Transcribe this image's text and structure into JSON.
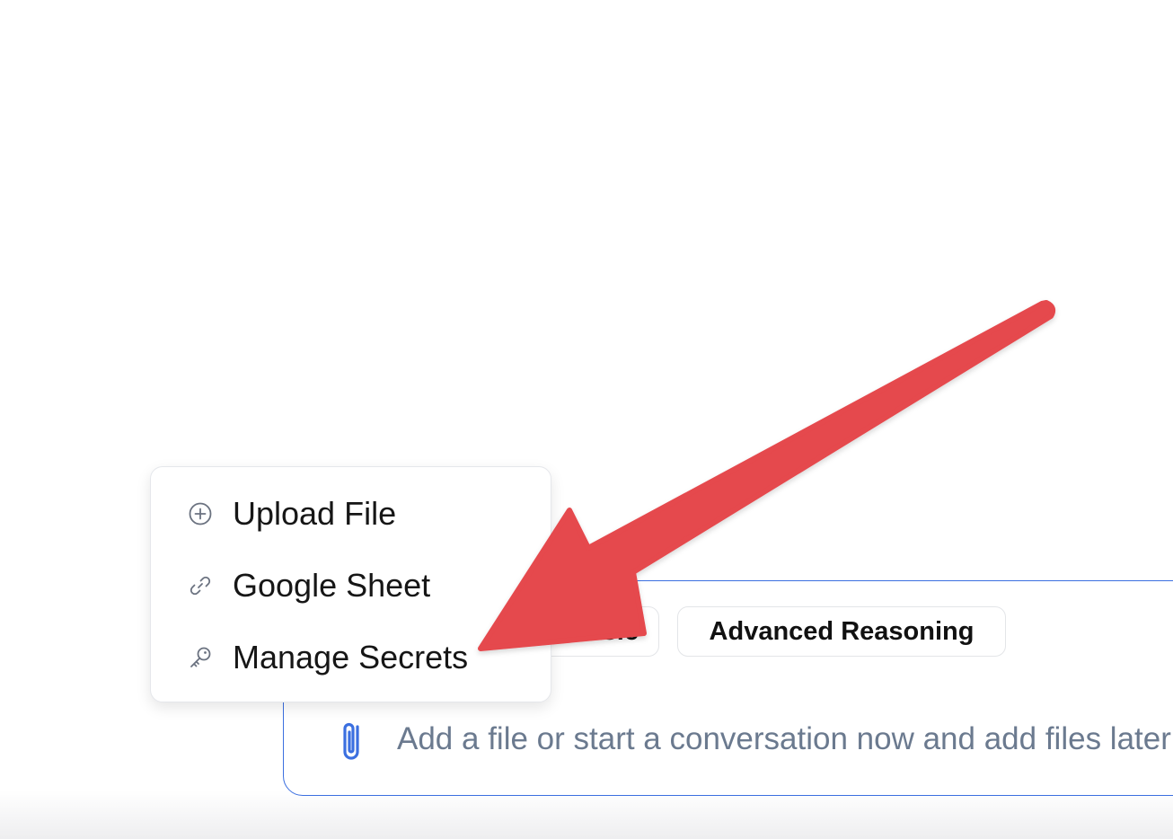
{
  "composer": {
    "chip_partial_label": "Basic",
    "chip_advanced_label": "Advanced Reasoning",
    "placeholder": "Add a file or start a conversation now and add files later"
  },
  "dropdown": {
    "items": [
      {
        "label": "Upload File",
        "icon": "plus-circle-icon"
      },
      {
        "label": "Google Sheet",
        "icon": "link-icon"
      },
      {
        "label": "Manage Secrets",
        "icon": "key-icon"
      }
    ]
  },
  "colors": {
    "accent": "#3b6fe0",
    "annotation_arrow": "#e5484d",
    "placeholder_text": "#6b7a8f",
    "menu_icon": "#6b7280"
  }
}
